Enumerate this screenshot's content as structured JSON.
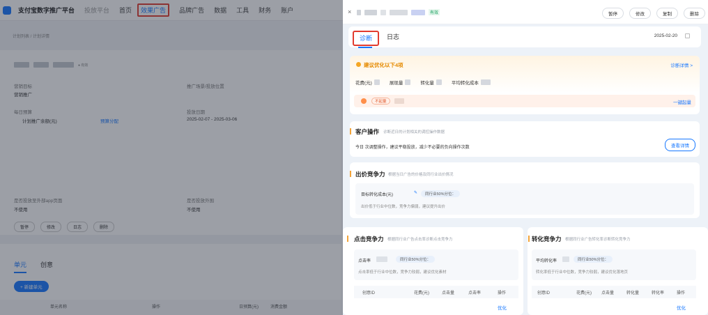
{
  "topnav": {
    "brand": "支付宝数字推广平台",
    "tabs": [
      "投放平台",
      "首页",
      "效果广告",
      "品牌广告",
      "数据",
      "工具",
      "财务",
      "账户"
    ]
  },
  "left": {
    "breadcrumb": "计划列表 / 计划详情",
    "status": "● 有效",
    "fields": {
      "plan_type_label": "营销目标",
      "plan_type_value": "营销推广",
      "delivery_label": "推广场景/投放位置",
      "budget_label": "每日预算",
      "budget_value": "计划推广余额(元)",
      "budget_link": "预算分配",
      "period_label": "投放日期",
      "period_value": "2025-02-07 - 2025-03-06",
      "landing_label": "是否投放至外部app页面",
      "landing_value": "不使用",
      "region_label": "是否投放外围",
      "region_value": "不使用"
    },
    "buttons": [
      "暂停",
      "修改",
      "日志",
      "删除"
    ],
    "tabs": [
      "单元",
      "创意"
    ],
    "new_unit": "+ 新建单元",
    "table_head": [
      "单元名称",
      "操作",
      "日预算(元)",
      "消费金额"
    ]
  },
  "panel": {
    "close": "×",
    "status": "有效",
    "actions": [
      "暂停",
      "修改",
      "复制",
      "删除"
    ],
    "tabs": {
      "diagnose": "诊断",
      "log": "日志"
    },
    "date": "2025-02-20",
    "suggest": {
      "title": "建议优化以下4项",
      "detail_link": "诊断详情 >",
      "metrics": [
        "花费(元)",
        "展现量",
        "转化量",
        "平均转化成本"
      ],
      "tag": "不起量",
      "fix_all": "一键起量"
    },
    "customer": {
      "title": "客户操作",
      "subtitle": "诊断近日的计划相关的调控操作数据",
      "body": "今日   次调整操作，建议平稳投放，减少不必要的负向操作次数",
      "button": "查看详情"
    },
    "bid": {
      "title": "出价竞争力",
      "subtitle": "根据当日广告的价格及同行业出价情况",
      "field": "目标转化成本(元)",
      "pill": "同行业50%分位：",
      "hint": "出价低于行业中位数，竞争力偏弱，建议提升出价"
    },
    "click": {
      "title": "点击竞争力",
      "subtitle": "根据同行业广告点击率诊断点击竞争力",
      "metric": "点击率",
      "pill": "同行业50%分位：",
      "hint": "点击率低于行业中位数，竞争力较弱，建议优化素材",
      "table_head": [
        "创意ID",
        "花费(元)",
        "点击量",
        "点击率",
        "操作"
      ],
      "action": "优化"
    },
    "convert": {
      "title": "转化竞争力",
      "subtitle": "根据同行业广告转化率诊断转化竞争力",
      "metric": "平均转化率",
      "pill": "同行业50%分位：",
      "hint": "转化率低于行业中位数，竞争力较弱，建议优化落地页",
      "table_head": [
        "创意ID",
        "花费(元)",
        "点击量",
        "转化量",
        "转化率",
        "操作"
      ],
      "action": "优化"
    }
  }
}
